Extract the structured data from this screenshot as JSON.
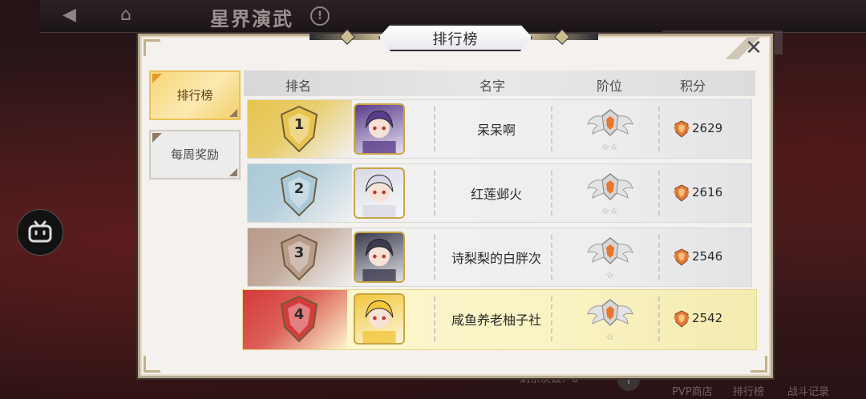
{
  "topbar": {
    "title": "星界演武",
    "back_icon": "back-arrow-icon",
    "home_icon": "home-icon",
    "help_label": "!"
  },
  "modal": {
    "title": "排行榜",
    "close_label": "✕"
  },
  "tabs": [
    {
      "label": "排行榜",
      "active": true
    },
    {
      "label": "每周奖励",
      "active": false
    }
  ],
  "table": {
    "headers": {
      "rank": "排名",
      "name": "名字",
      "tier": "阶位",
      "score": "积分"
    },
    "rows": [
      {
        "rank": "1",
        "name": "呆呆啊",
        "stars": "☆☆",
        "score": "2629",
        "rank_color": "#e7c44c",
        "avatar_color": "#5a3d8c",
        "highlight": false
      },
      {
        "rank": "2",
        "name": "红莲邺火",
        "stars": "☆☆",
        "score": "2616",
        "rank_color": "#a9c9d8",
        "avatar_color": "#d9d9e6",
        "highlight": false
      },
      {
        "rank": "3",
        "name": "诗梨梨的白胖次",
        "stars": "☆",
        "score": "2546",
        "rank_color": "#b89a88",
        "avatar_color": "#3b3b4f",
        "highlight": false
      },
      {
        "rank": "4",
        "name": "咸鱼养老柚子社",
        "stars": "☆",
        "score": "2542",
        "rank_color": "#d43a3a",
        "avatar_color": "#f2c73c",
        "highlight": true
      }
    ]
  },
  "bottom": {
    "remaining": "剩余次数：0",
    "pvp_shop": "PVP商店",
    "ranking": "排行榜",
    "battle_log": "战斗记录"
  },
  "colors": {
    "accent_gold": "#f3d06a",
    "highlight_row": "#faf3c4"
  }
}
